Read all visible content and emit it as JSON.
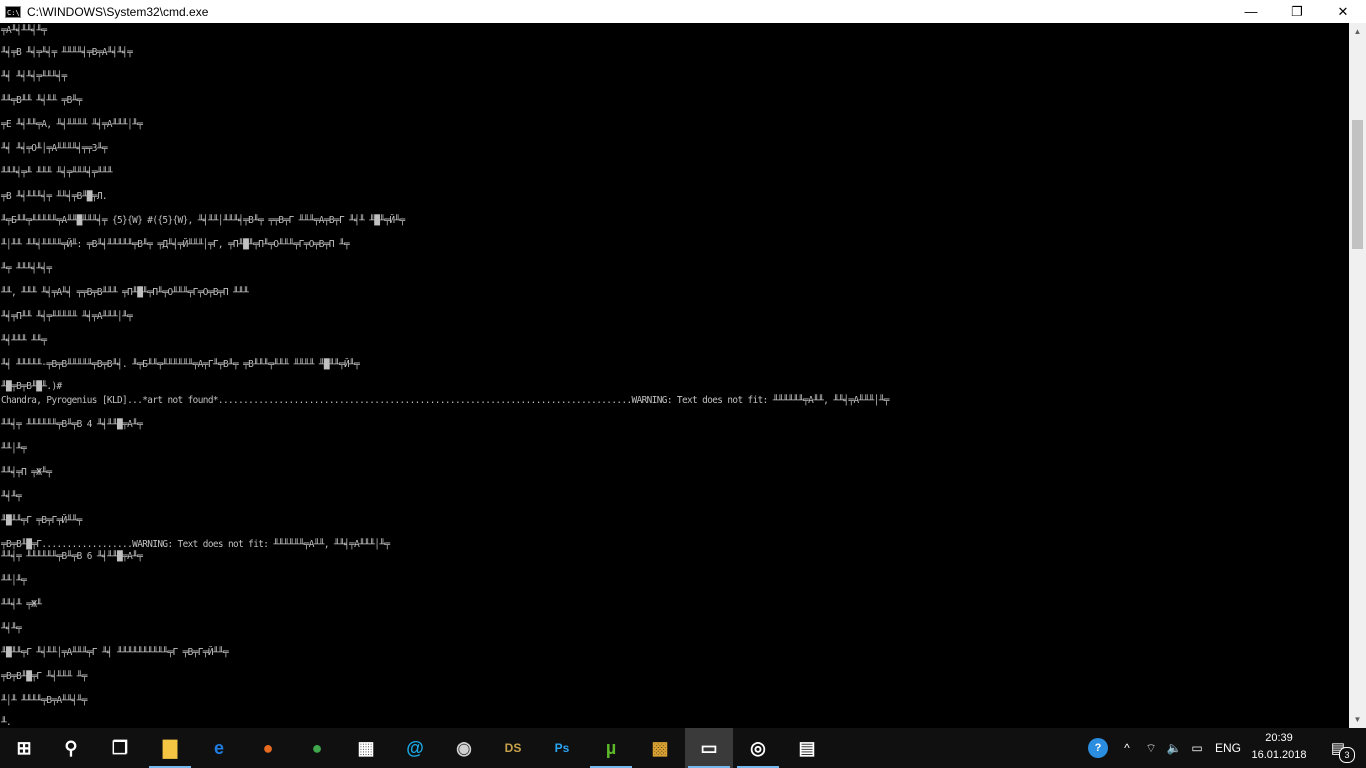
{
  "window": {
    "title": "C:\\WINDOWS\\System32\\cmd.exe",
    "minimize": "—",
    "restore": "❐",
    "close": "✕"
  },
  "console": {
    "lines": [
      "╤А╨╡╨╨╡╨╤",
      "╨╡╤В ╨╡╤╨╡╤ ╨╨╨╨╡╤В╤А╨╡╨╡╤",
      "╨╡ ╨╡╨╡╤╨╨╨╡╤",
      "╨╨╤В╨╨ ╨╡╨╨ ╤В╨╤",
      "╤Е ╨╡╨╨╤А, ╨╡╨╨╨╨ ╨╡╤А╨╨╨│╨╤",
      "╨╡ ╨╡╤О╨│╤А╨╨╨╨╡╤╤З╨╤",
      "╨╨╨╡╤╨ ╨╨╨ ╨╡╤╨╨╨╡╤╨╨╨",
      "╤В ╨╡╨╨╨╡╤ ╨╨╡╤В╨█╤Л.",
      "╨╤Б╨╨╤╨╨╨╨╨╤А╨╨█╨╨╨╡╤ {5}{W} #({5}{W}, ╨╡╨╨│╨╨╨╡╤В╨╤ ╤╤В╤Г ╨╨╨╤А╤В╤Г ╨╡╨ ╨█╨╤Й╨╤",
      "╨│╨╨ ╨╨╡╨╨╨╨╤Й╨: ╤В╨╡╨╨╨╨╨╤В╨╤ ╤Д╨╡╤Й╨╨╨│╤Г, ╤П╨█╨╤П╨╤О╨╨╨╤Г╤О╤В╤П ╨╤",
      "╨╤ ╨╨╨╡╨╡╤",
      "╨╨, ╨╨╨ ╨╡╤А╨╡ ╤╤В╤В╨╨╨ ╤П╨█╨╤П╨╤О╨╨╨╤Г╤О╤В╤П ╨╨╨",
      "╨╡╤П╨╨ ╨╡╤╨╨╨╨╨ ╨╡╤А╨╨╨│╨╤",
      "╨╡╨╨╨ ╨╨╤",
      "╨╡ ╨╨╨╨╨-╤В╤В╨╨╨╨╨╤В╤В╨╡. ╨╤Б╨╨╤╨╨╨╨╨╨╤А╤Г╨╤В╨╤ ╤В╨╨╨╤╨╨╨ ╨╨╨╨ ╨█╨╨╤Й╨╤",
      "╨█╤В╤В╨█╨.)#",
      "Chandra, Pyrogenius [KLD]...*art not found*..................................................................................WARNING: Text does not fit: ╨╨╨╨╨╨╤А╨╨, ╨╨╡╤А╨╨╨│╨╤",
      "╨╨╡╤ ╨╨╨╨╨╨╤В╨╤В 4 ╨╡╨╨█╤А╨╤",
      "╨╨│╨╤",
      "╨╨╡╤П ╤Ж╨╤",
      "╨╡╨╤",
      "╨█╨╨╤Г ╤В╤Г╤Й╨╨╤",
      "╤В╤В╨█╤Г..................WARNING: Text does not fit: ╨╨╨╨╨╨╤А╨╨, ╨╨╡╤А╨╨╨│╨╤",
      "╨╨╡╤ ╨╨╨╨╨╨╤В╨╤В 6 ╨╡╨╨█╤А╨╤",
      "╨╨│╨╤",
      "╨╨╡╨ ╤Ж╨",
      "╨╡╨╤",
      "╨█╨╨╤Г ╨╡╨╨│╤А╨╨╨╤Г ╨╡ ╨╨╨╨╨╨╨╨╨╨╤Г ╤В╤Г╤Й╨╨╤",
      "╤В╤В╨█╤Г ╨╡╨╨╨ ╨╤",
      "╨│╨ ╨╨╨╨╤В╤А╨╨╡╨╤",
      "╨."
    ]
  },
  "taskbar": {
    "apps": [
      {
        "name": "start-button",
        "label": "⊞",
        "color": "#ffffff"
      },
      {
        "name": "search-button",
        "label": "⚲",
        "color": "#ffffff"
      },
      {
        "name": "task-view-button",
        "label": "❐",
        "color": "#ffffff"
      },
      {
        "name": "file-explorer-icon",
        "label": "▇",
        "color": "#f4c542"
      },
      {
        "name": "edge-icon",
        "label": "e",
        "color": "#1f7ce0"
      },
      {
        "name": "firefox-icon",
        "label": "●",
        "color": "#e66a1f"
      },
      {
        "name": "chrome-icon",
        "label": "●",
        "color": "#3fa84d"
      },
      {
        "name": "store-icon",
        "label": "▦",
        "color": "#ffffff"
      },
      {
        "name": "mail-icon",
        "label": "@",
        "color": "#1aa9e6"
      },
      {
        "name": "camera-app-icon",
        "label": "◉",
        "color": "#d0d0d0"
      },
      {
        "name": "ds-app-icon",
        "label": "DS",
        "color": "#c8a24a"
      },
      {
        "name": "photoshop-icon",
        "label": "Ps",
        "color": "#2aa4f4"
      },
      {
        "name": "utorrent-icon",
        "label": "µ",
        "color": "#5cb82a"
      },
      {
        "name": "game-app-icon",
        "label": "▩",
        "color": "#d9a233"
      },
      {
        "name": "cmd-icon",
        "label": "▭",
        "color": "#ffffff"
      },
      {
        "name": "media-app-icon",
        "label": "◎",
        "color": "#ffffff"
      },
      {
        "name": "notepad-icon",
        "label": "▤",
        "color": "#ffffff"
      }
    ],
    "tray": {
      "help": "?",
      "chevron": "^",
      "network": "⌔",
      "volume": "🔈",
      "battery": "▭",
      "language": "ENG",
      "time": "20:39",
      "date": "16.01.2018",
      "notifications": "3"
    }
  }
}
